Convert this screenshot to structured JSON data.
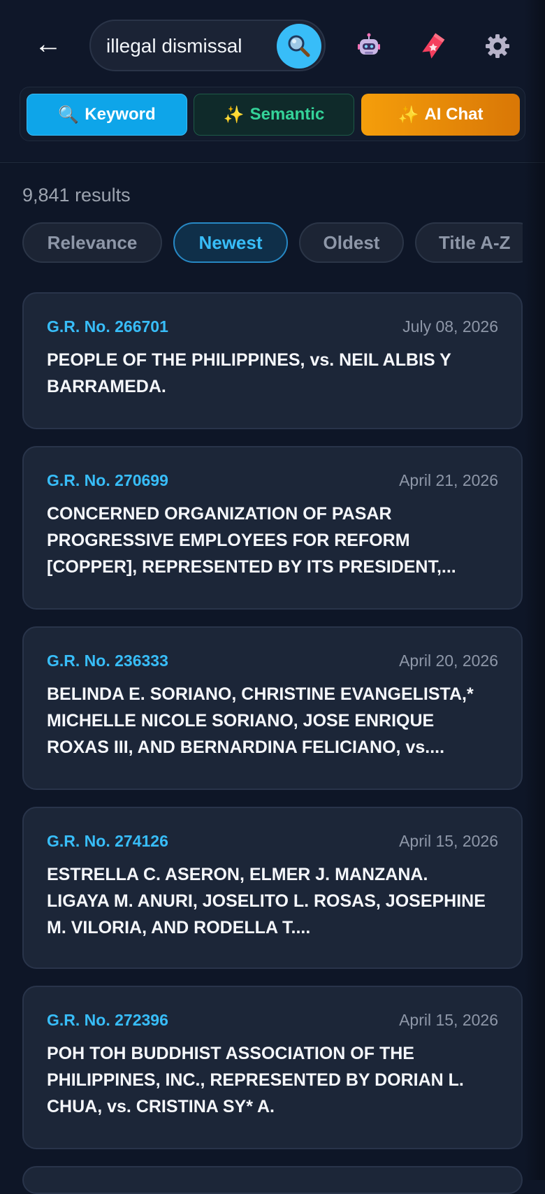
{
  "header": {
    "back_icon": "←",
    "search": {
      "value": "illegal dismissal",
      "placeholder": ""
    },
    "icons": {
      "search": "search-icon",
      "bot": "robot-icon",
      "bookmark": "bookmark-icon",
      "settings": "gear-icon"
    }
  },
  "modes": {
    "keyword": {
      "emoji": "🔍",
      "label": "Keyword"
    },
    "semantic": {
      "emoji": "✨",
      "label": "Semantic"
    },
    "ai_chat": {
      "emoji": "✨",
      "label": "AI Chat"
    }
  },
  "results": {
    "count_text": "9,841 results"
  },
  "sort": {
    "options": [
      "Relevance",
      "Newest",
      "Oldest",
      "Title A-Z"
    ],
    "active": "Newest"
  },
  "cases": [
    {
      "gr": "G.R. No. 266701",
      "date": "July 08, 2026",
      "title": "PEOPLE OF THE PHILIPPINES, vs. NEIL ALBIS Y BARRAMEDA."
    },
    {
      "gr": "G.R. No. 270699",
      "date": "April 21, 2026",
      "title": "CONCERNED ORGANIZATION OF PASAR PROGRESSIVE EMPLOYEES FOR REFORM [COPPER], REPRESENTED BY ITS PRESIDENT,..."
    },
    {
      "gr": "G.R. No. 236333",
      "date": "April 20, 2026",
      "title": "BELINDA E. SORIANO, CHRISTINE EVANGELISTA,* MICHELLE NICOLE SORIANO, JOSE ENRIQUE ROXAS III, AND BERNARDINA FELICIANO, vs...."
    },
    {
      "gr": "G.R. No. 274126",
      "date": "April 15, 2026",
      "title": "ESTRELLA C. ASERON, ELMER J. MANZANA. LIGAYA M. ANURI, JOSELITO L. ROSAS, JOSEPHINE M. VILORIA, AND RODELLA T...."
    },
    {
      "gr": "G.R. No. 272396",
      "date": "April 15, 2026",
      "title": "POH TOH BUDDHIST ASSOCIATION OF THE PHILIPPINES, INC., REPRESENTED BY DORIAN L. CHUA, vs. CRISTINA SY* A."
    }
  ],
  "colors": {
    "background": "#0e1627",
    "accent": "#38bdf8",
    "semantic": "#34d399",
    "ai": "#f59e0b",
    "card": "#1c2638"
  }
}
